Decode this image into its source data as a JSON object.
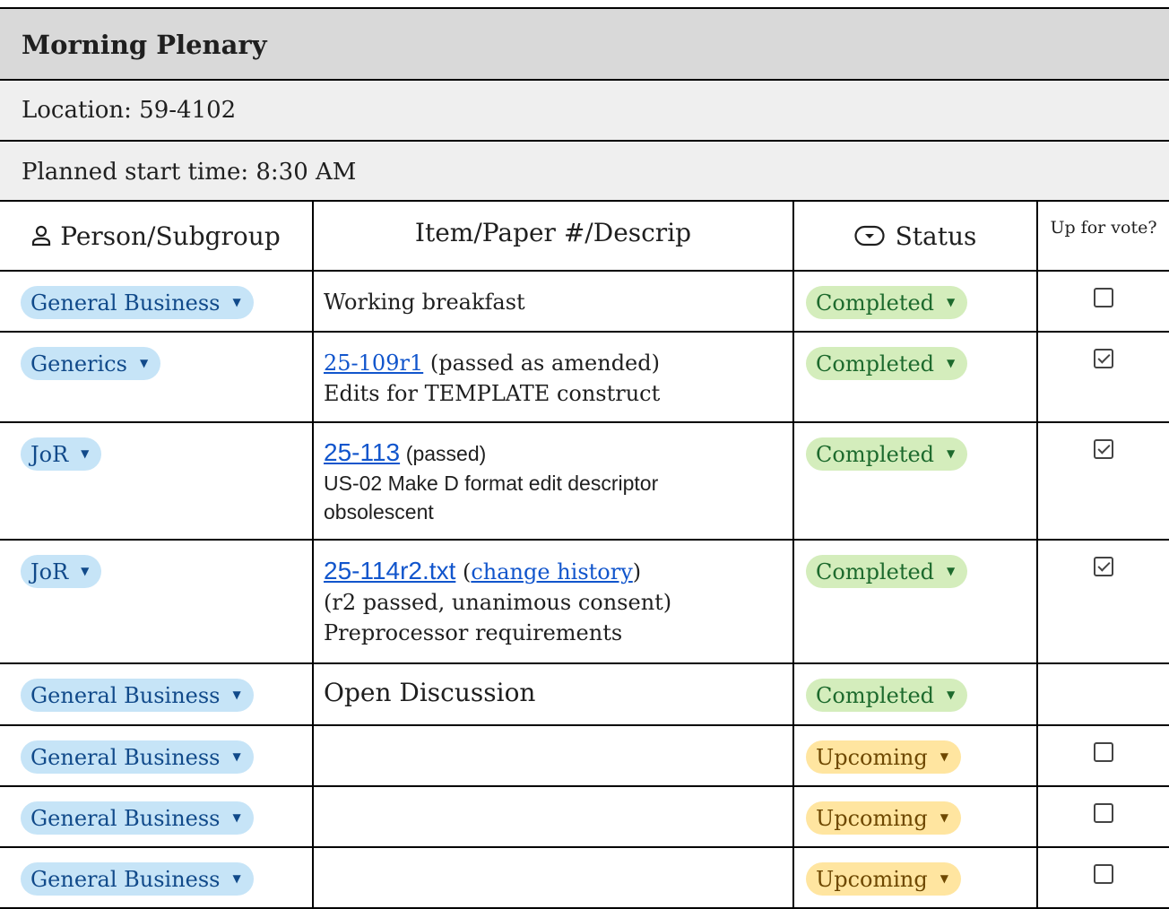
{
  "header": {
    "title": "Morning Plenary",
    "location": "Location: 59-4102",
    "start_time": "Planned start time: 8:30 AM"
  },
  "columns": {
    "person": "Person/Subgroup",
    "item": "Item/Paper #/Descrip",
    "status": "Status",
    "vote": "Up for vote?"
  },
  "icons": {
    "person_header": "person-icon",
    "status_header": "dropdown-chip-icon",
    "chip_caret": "caret-down-icon"
  },
  "colors": {
    "subgroup_chip": "#c6e4f7",
    "completed_chip": "#d4edbc",
    "upcoming_chip": "#ffe5a0",
    "link": "#1155cc"
  },
  "rows": [
    {
      "person": "General Business",
      "item_text": "Working breakfast",
      "status": "Completed",
      "vote_checked": false
    },
    {
      "person": "Generics",
      "link": "25-109r1",
      "note": "(passed as amended)",
      "desc": "Edits for TEMPLATE construct",
      "status": "Completed",
      "vote_checked": true
    },
    {
      "person": "JoR",
      "link": "25-113",
      "note": "(passed)",
      "desc": "US-02 Make D format edit descriptor obsolescent",
      "status": "Completed",
      "vote_checked": true
    },
    {
      "person": "JoR",
      "link": "25-114r2.txt",
      "link2": "change history",
      "note": "(r2 passed, unanimous consent)",
      "desc": "Preprocessor requirements",
      "status": "Completed",
      "vote_checked": true
    },
    {
      "person": "General Business",
      "item_text": "Open Discussion",
      "status": "Completed"
    },
    {
      "person": "General Business",
      "item_text": "",
      "status": "Upcoming",
      "vote_checked": false
    },
    {
      "person": "General Business",
      "item_text": "",
      "status": "Upcoming",
      "vote_checked": false
    },
    {
      "person": "General Business",
      "item_text": "",
      "status": "Upcoming",
      "vote_checked": false
    }
  ]
}
